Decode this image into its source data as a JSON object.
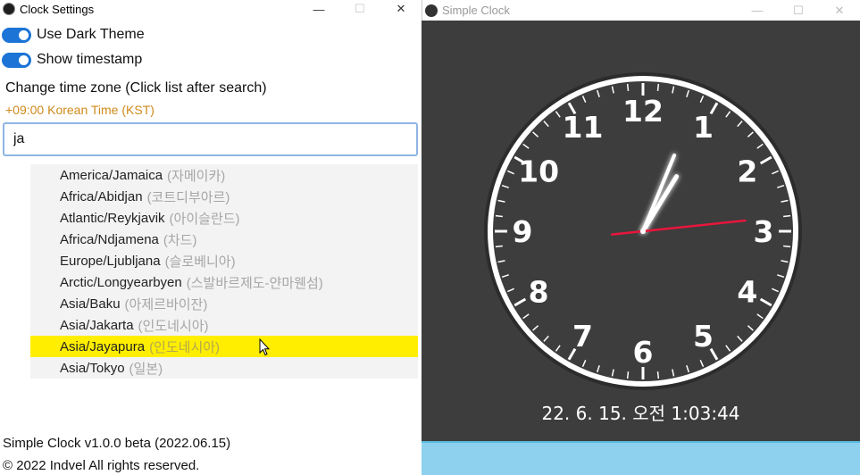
{
  "settings": {
    "title": "Clock Settings",
    "controls": {
      "minimize": "—",
      "maximize": "☐",
      "close": "✕"
    },
    "dark_theme_label": "Use Dark Theme",
    "dark_theme_on": true,
    "timestamp_label": "Show timestamp",
    "timestamp_on": true,
    "tz_heading": "Change time zone (Click list after search)",
    "tz_current": "+09:00 Korean Time (KST)",
    "search_value": "ja",
    "tz_items": [
      {
        "name": "America/Jamaica",
        "kor": "(자메이카)"
      },
      {
        "name": "Africa/Abidjan",
        "kor": "(코트디부아르)"
      },
      {
        "name": "Atlantic/Reykjavik",
        "kor": "(아이슬란드)"
      },
      {
        "name": "Africa/Ndjamena",
        "kor": "(차드)"
      },
      {
        "name": "Europe/Ljubljana",
        "kor": "(슬로베니아)"
      },
      {
        "name": "Arctic/Longyearbyen",
        "kor": "(스발바르제도-얀마웬섬)"
      },
      {
        "name": "Asia/Baku",
        "kor": "(아제르바이잔)"
      },
      {
        "name": "Asia/Jakarta",
        "kor": "(인도네시아)"
      },
      {
        "name": "Asia/Jayapura",
        "kor": "(인도네시아)"
      },
      {
        "name": "Asia/Tokyo",
        "kor": "(일본)"
      }
    ],
    "selected_index": 8,
    "footer_version": "Simple Clock v1.0.0 beta (2022.06.15)",
    "footer_copyright": "© 2022 Indvel All rights reserved."
  },
  "clock": {
    "title": "Simple Clock",
    "controls": {
      "minimize": "—",
      "maximize": "☐",
      "close": "✕"
    },
    "numerals": [
      "12",
      "1",
      "2",
      "3",
      "4",
      "5",
      "6",
      "7",
      "8",
      "9",
      "10",
      "11"
    ],
    "time": {
      "hour": 1,
      "minute": 3,
      "second": 44
    },
    "timestamp": "22. 6. 15. 오전 1:03:44",
    "colors": {
      "background": "#3d3d3d",
      "face": "#3d3d3d",
      "second_hand": "#e8163c",
      "accent_bar": "#8dd1ef",
      "toggle": "#1b74d6",
      "selection": "#ffee00",
      "current_tz": "#d08a1a"
    }
  }
}
